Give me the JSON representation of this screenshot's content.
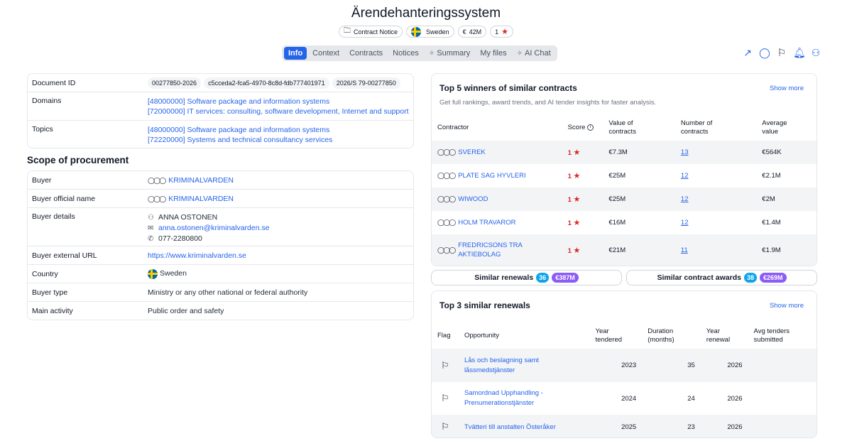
{
  "header": {
    "title": "Ärendehanteringssystem",
    "chips": {
      "notice": "Contract Notice",
      "country": "Sweden",
      "value": "42M",
      "currency": "€",
      "rating": "1"
    }
  },
  "tabs": [
    "Info",
    "Context",
    "Contracts",
    "Notices",
    "Summary",
    "My files",
    "AI Chat"
  ],
  "info": {
    "labels": {
      "doc_id": "Document ID",
      "domains": "Domains",
      "topics": "Topics"
    },
    "doc_ids": [
      "00277850-2026",
      "c5cceda2-fca5-4970-8c8d-fdb777401971",
      "2026/S 79-00277850"
    ],
    "domains": [
      "[48000000] Software package and information systems",
      "[72000000] IT services: consulting, software development, Internet and support"
    ],
    "topics": [
      "[48000000] Software package and information systems",
      "[72220000] Systems and technical consultancy services"
    ]
  },
  "scope": {
    "title": "Scope of procurement",
    "labels": {
      "buyer": "Buyer",
      "official": "Buyer official name",
      "details": "Buyer details",
      "url": "Buyer external URL",
      "country": "Country",
      "type": "Buyer type",
      "activity": "Main activity"
    },
    "buyer": "KRIMINALVARDEN",
    "official": "KRIMINALVARDEN",
    "contact_name": "ANNA OSTONEN",
    "contact_email": "anna.ostonen@kriminalvarden.se",
    "contact_phone": "077-2280800",
    "url": "https://www.kriminalvarden.se",
    "country": "Sweden",
    "type": "Ministry or any other national or federal authority",
    "activity": "Public order and safety"
  },
  "winners": {
    "title": "Top 5 winners of similar contracts",
    "subtitle": "Get full rankings, award trends, and AI tender insights for faster analysis.",
    "show_more": "Show more",
    "headers": {
      "contractor": "Contractor",
      "score": "Score",
      "value1": "Value of",
      "value2": "contracts",
      "number1": "Number of",
      "number2": "contracts",
      "avg1": "Average",
      "avg2": "value"
    },
    "rows": [
      {
        "name": "SVEREK",
        "score": "1",
        "value": "€7.3M",
        "count": "13",
        "avg": "€564K"
      },
      {
        "name": "PLATE SAG HYVLERI",
        "score": "1",
        "value": "€25M",
        "count": "12",
        "avg": "€2.1M"
      },
      {
        "name": "WIWOOD",
        "score": "1",
        "value": "€25M",
        "count": "12",
        "avg": "€2M"
      },
      {
        "name": "HOLM TRAVAROR",
        "score": "1",
        "value": "€16M",
        "count": "12",
        "avg": "€1.4M"
      },
      {
        "name": "FREDRICSONS TRA AKTIEBOLAG",
        "score": "1",
        "value": "€21M",
        "count": "11",
        "avg": "€1.9M"
      }
    ]
  },
  "buttons": {
    "renewals_label": "Similar renewals",
    "renewals_count": "36",
    "renewals_value": "€387M",
    "awards_label": "Similar contract awards",
    "awards_count": "38",
    "awards_value": "€269M"
  },
  "renewals": {
    "title": "Top 3 similar renewals",
    "show_more": "Show more",
    "headers": {
      "flag": "Flag",
      "opportunity": "Opportunity",
      "year1": "Year",
      "year2": "tendered",
      "dur1": "Duration",
      "dur2": "(months)",
      "ren1": "Year",
      "ren2": "renewal",
      "avg1": "Avg tenders",
      "avg2": "submitted"
    },
    "rows": [
      {
        "opportunity": "Lås och beslagning samt låssmedstjänster",
        "year": "2023",
        "duration": "35",
        "renewal": "2026"
      },
      {
        "opportunity": "Samordnad Upphandling - Prenumerationstjänster",
        "year": "2024",
        "duration": "24",
        "renewal": "2026"
      },
      {
        "opportunity": "Tvätteri till anstalten Österåker",
        "year": "2025",
        "duration": "23",
        "renewal": "2026"
      }
    ]
  }
}
